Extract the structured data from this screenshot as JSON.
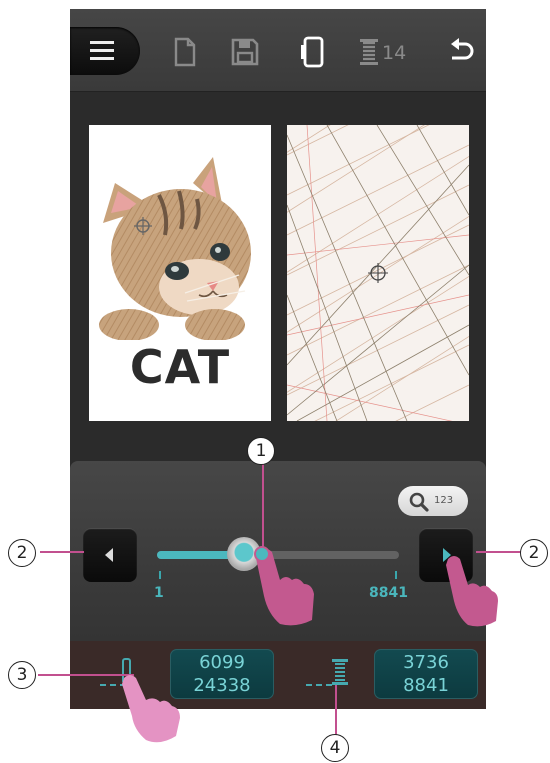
{
  "toolbar": {
    "icons": [
      "menu-icon",
      "new-file-icon",
      "save-icon",
      "frame-icon",
      "thread-spool-icon",
      "undo-icon"
    ],
    "spool_count": "14"
  },
  "preview": {
    "left_label": "CAT"
  },
  "control": {
    "zoom_label": "123",
    "slider": {
      "min_label": "1",
      "max_label": "8841",
      "min": 1,
      "max": 8841,
      "value_fraction": 0.36
    }
  },
  "counters": {
    "stitch_current": "6099",
    "stitch_total": "24338",
    "color_current": "3736",
    "color_total": "8841"
  },
  "callouts": {
    "slider": "1",
    "nav_left": "2",
    "nav_right": "2",
    "stitch": "3",
    "color": "4"
  },
  "colors": {
    "accent": "#4bb8be",
    "counter_text": "#79d3d6",
    "leader": "#c2508f",
    "hand": "#c3598f"
  }
}
